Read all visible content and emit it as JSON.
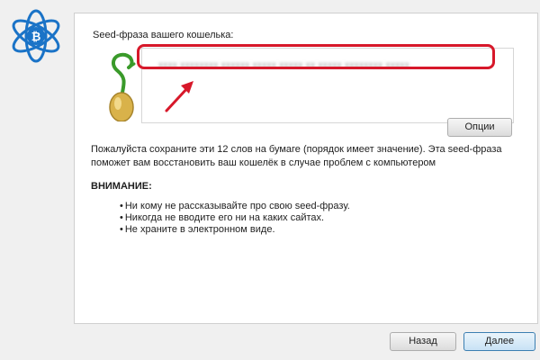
{
  "colors": {
    "highlight": "#d7182a",
    "arrow": "#d7182a",
    "logo": "#1a73c7"
  },
  "icons": {
    "logo": "electrum-logo-icon",
    "seed": "seed-sprout-icon",
    "arrow": "red-arrow-icon"
  },
  "wizard": {
    "seed_label": "Seed-фраза вашего кошелька:",
    "seed_phrase_obscured": "xxxx xxxxxxxx xxxxxx xxxxx xxxxx xx xxxxx xxxxxxxx xxxxx",
    "options_button": "Опции",
    "info_text": "Пожалуйста сохраните эти 12 слов на бумаге (порядок имеет значение). Эта seed-фраза поможет вам восстановить ваш кошелёк в случае проблем с компьютером",
    "warning_title": "ВНИМАНИЕ:",
    "warnings": [
      "Ни кому не рассказывайте про свою seed-фразу.",
      "Никогда не вводите его ни на каких сайтах.",
      "Не храните в электронном виде."
    ]
  },
  "footer": {
    "back_button": "Назад",
    "next_button": "Далее"
  }
}
